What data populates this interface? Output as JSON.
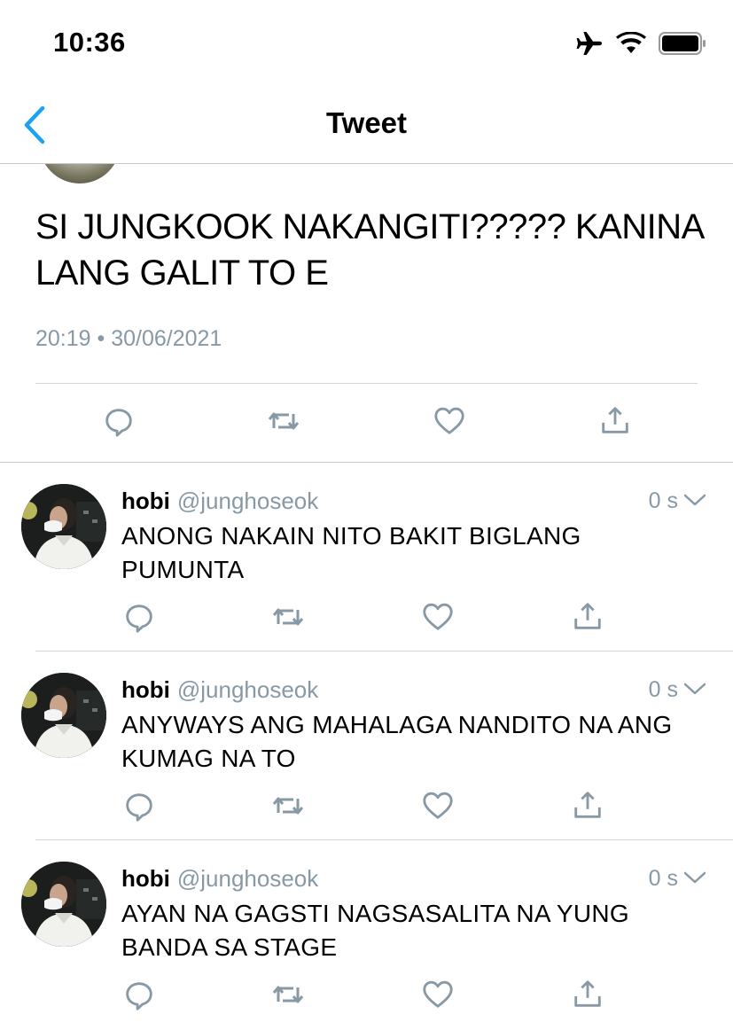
{
  "status_bar": {
    "time": "10:36",
    "icons": [
      "airplane-icon",
      "wifi-icon",
      "battery-icon"
    ]
  },
  "nav": {
    "title": "Tweet",
    "back_icon": "chevron-left-icon"
  },
  "main_tweet": {
    "text": "SI JUNGKOOK NAKANGITI????? KANINA LANG GALIT TO E",
    "date": "20:19 • 30/06/2021"
  },
  "actions": [
    "reply-icon",
    "retweet-icon",
    "like-icon",
    "share-icon"
  ],
  "replies": [
    {
      "name": "hobi",
      "handle": "@junghoseok",
      "age": "0 s",
      "text": "ANONG NAKAIN NITO BAKIT BIGLANG PUMUNTA"
    },
    {
      "name": "hobi",
      "handle": "@junghoseok",
      "age": "0 s",
      "text": "ANYWAYS ANG MAHALAGA NANDITO NA ANG KUMAG NA TO"
    },
    {
      "name": "hobi",
      "handle": "@junghoseok",
      "age": "0 s",
      "text": "AYAN NA GAGSTI NAGSASALITA NA YUNG BANDA SA STAGE"
    }
  ],
  "colors": {
    "accent": "#1da1f2",
    "muted": "#8899a6",
    "divider": "#d6d6d6"
  }
}
